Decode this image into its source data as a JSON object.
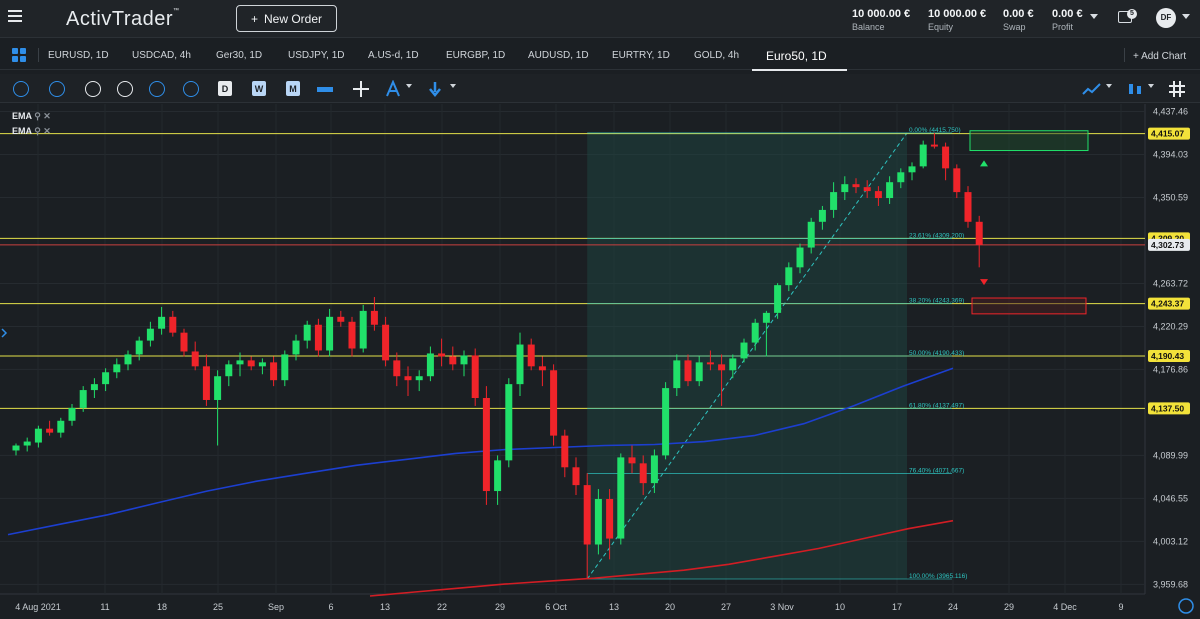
{
  "header": {
    "logo": "ActivTrader",
    "logo_tm": "™",
    "new_order": "New Order",
    "new_order_plus": "+",
    "balance": {
      "value": "10 000.00 €",
      "label": "Balance"
    },
    "equity": {
      "value": "10 000.00 €",
      "label": "Equity"
    },
    "swap": {
      "value": "0.00 €",
      "label": "Swap"
    },
    "profit": {
      "value": "0.00 €",
      "label": "Profit"
    },
    "notifications": "5",
    "avatar": "DF"
  },
  "tabs": [
    {
      "label": "EURUSD, 1D"
    },
    {
      "label": "USDCAD, 4h"
    },
    {
      "label": "Ger30, 1D"
    },
    {
      "label": "USDJPY, 1D"
    },
    {
      "label": "A.US-d, 1D"
    },
    {
      "label": "EURGBP, 1D"
    },
    {
      "label": "AUDUSD, 1D"
    },
    {
      "label": "EURTRY, 1D"
    },
    {
      "label": "GOLD, 4h"
    },
    {
      "label": "Euro50, 1D"
    }
  ],
  "active_tab": "Euro50, 1D",
  "add_chart": "+ Add Chart",
  "toolbar": {
    "letter_tools": [
      "D",
      "W",
      "M"
    ]
  },
  "indicators": [
    {
      "label": "EMA"
    },
    {
      "label": "EMA"
    }
  ],
  "colors": {
    "up": "#21e06a",
    "down": "#f0242a",
    "ema_fast": "#1c3fd0",
    "ema_slow": "#d21d24",
    "accent": "#2f8ee8",
    "level": "#e3e04a",
    "fib": "#2ec4c0"
  },
  "chart_data": {
    "type": "candlestick",
    "instrument": "Euro50",
    "timeframe": "1D",
    "y_ticks": [
      "4,437.46",
      "4,394.03",
      "4,350.59",
      "4,263.72",
      "4,220.29",
      "4,176.86",
      "4,089.99",
      "4,046.55",
      "4,003.12",
      "3,959.68"
    ],
    "x_ticks": [
      "4 Aug 2021",
      "11",
      "18",
      "25",
      "Sep",
      "6",
      "13",
      "22",
      "29",
      "6 Oct",
      "13",
      "20",
      "27",
      "3 Nov",
      "10",
      "17",
      "24",
      "29",
      "4 Dec",
      "9"
    ],
    "levels": [
      {
        "price": 4415.07,
        "label": "4,415.07"
      },
      {
        "price": 4309.2,
        "label": "4,309.20"
      },
      {
        "price": 4302.73,
        "label": "4,302.73"
      },
      {
        "price": 4243.37,
        "label": "4,243.37"
      },
      {
        "price": 4190.43,
        "label": "4,190.43"
      },
      {
        "price": 4137.5,
        "label": "4,137.50"
      }
    ],
    "fibonacci": [
      {
        "price": 4415.75,
        "label": "0.00% (4415.750)"
      },
      {
        "price": 4309.2,
        "label": "23.61% (4309.200)"
      },
      {
        "price": 4243.369,
        "label": "38.20% (4243.369)"
      },
      {
        "price": 4190.433,
        "label": "50.00% (4190.433)"
      },
      {
        "price": 4137.497,
        "label": "61.80% (4137.497)"
      },
      {
        "price": 4071.667,
        "label": "76.40% (4071.667)"
      },
      {
        "price": 3965.116,
        "label": "100.00% (3965.116)"
      }
    ],
    "candles": [
      [
        4095,
        4102,
        4090,
        4100
      ],
      [
        4100,
        4108,
        4094,
        4104
      ],
      [
        4103,
        4120,
        4098,
        4117
      ],
      [
        4117,
        4125,
        4110,
        4113
      ],
      [
        4113,
        4128,
        4108,
        4125
      ],
      [
        4125,
        4142,
        4120,
        4138
      ],
      [
        4138,
        4160,
        4134,
        4156
      ],
      [
        4156,
        4168,
        4148,
        4162
      ],
      [
        4162,
        4178,
        4155,
        4174
      ],
      [
        4174,
        4188,
        4168,
        4182
      ],
      [
        4182,
        4196,
        4176,
        4192
      ],
      [
        4192,
        4210,
        4186,
        4206
      ],
      [
        4206,
        4225,
        4200,
        4218
      ],
      [
        4218,
        4240,
        4212,
        4230
      ],
      [
        4230,
        4236,
        4210,
        4214
      ],
      [
        4214,
        4218,
        4190,
        4195
      ],
      [
        4195,
        4205,
        4176,
        4180
      ],
      [
        4180,
        4192,
        4140,
        4146
      ],
      [
        4146,
        4176,
        4100,
        4170
      ],
      [
        4170,
        4186,
        4160,
        4182
      ],
      [
        4182,
        4194,
        4170,
        4186
      ],
      [
        4186,
        4190,
        4176,
        4180
      ],
      [
        4180,
        4188,
        4172,
        4184
      ],
      [
        4184,
        4190,
        4160,
        4166
      ],
      [
        4166,
        4196,
        4160,
        4192
      ],
      [
        4192,
        4212,
        4186,
        4206
      ],
      [
        4206,
        4226,
        4198,
        4222
      ],
      [
        4222,
        4228,
        4190,
        4196
      ],
      [
        4196,
        4238,
        4190,
        4230
      ],
      [
        4230,
        4236,
        4220,
        4225
      ],
      [
        4225,
        4230,
        4190,
        4198
      ],
      [
        4198,
        4242,
        4194,
        4236
      ],
      [
        4236,
        4250,
        4216,
        4222
      ],
      [
        4222,
        4230,
        4180,
        4186
      ],
      [
        4186,
        4194,
        4160,
        4170
      ],
      [
        4170,
        4180,
        4150,
        4166
      ],
      [
        4166,
        4176,
        4155,
        4170
      ],
      [
        4170,
        4200,
        4165,
        4193
      ],
      [
        4193,
        4208,
        4180,
        4190
      ],
      [
        4190,
        4200,
        4176,
        4182
      ],
      [
        4182,
        4196,
        4170,
        4191
      ],
      [
        4191,
        4198,
        4140,
        4148
      ],
      [
        4148,
        4160,
        4040,
        4054
      ],
      [
        4054,
        4090,
        4040,
        4085
      ],
      [
        4085,
        4168,
        4078,
        4162
      ],
      [
        4162,
        4214,
        4150,
        4202
      ],
      [
        4202,
        4208,
        4176,
        4180
      ],
      [
        4180,
        4190,
        4160,
        4176
      ],
      [
        4176,
        4182,
        4100,
        4110
      ],
      [
        4110,
        4116,
        4068,
        4078
      ],
      [
        4078,
        4088,
        4050,
        4060
      ],
      [
        4060,
        4072,
        3966,
        4000
      ],
      [
        4000,
        4056,
        3990,
        4046
      ],
      [
        4046,
        4056,
        3985,
        4006
      ],
      [
        4006,
        4092,
        4000,
        4088
      ],
      [
        4088,
        4100,
        4072,
        4082
      ],
      [
        4082,
        4090,
        4050,
        4062
      ],
      [
        4062,
        4096,
        4052,
        4090
      ],
      [
        4090,
        4164,
        4086,
        4158
      ],
      [
        4158,
        4192,
        4150,
        4186
      ],
      [
        4186,
        4192,
        4160,
        4165
      ],
      [
        4165,
        4190,
        4160,
        4184
      ],
      [
        4184,
        4196,
        4176,
        4182
      ],
      [
        4182,
        4192,
        4140,
        4176
      ],
      [
        4176,
        4192,
        4168,
        4188
      ],
      [
        4188,
        4208,
        4184,
        4204
      ],
      [
        4204,
        4228,
        4196,
        4224
      ],
      [
        4224,
        4236,
        4190,
        4234
      ],
      [
        4234,
        4264,
        4228,
        4262
      ],
      [
        4262,
        4285,
        4256,
        4280
      ],
      [
        4280,
        4304,
        4274,
        4300
      ],
      [
        4300,
        4330,
        4294,
        4326
      ],
      [
        4326,
        4342,
        4318,
        4338
      ],
      [
        4338,
        4366,
        4330,
        4356
      ],
      [
        4356,
        4372,
        4348,
        4364
      ],
      [
        4364,
        4370,
        4355,
        4361
      ],
      [
        4361,
        4368,
        4350,
        4357
      ],
      [
        4357,
        4362,
        4342,
        4350
      ],
      [
        4350,
        4372,
        4344,
        4366
      ],
      [
        4366,
        4380,
        4360,
        4376
      ],
      [
        4376,
        4386,
        4368,
        4382
      ],
      [
        4382,
        4408,
        4380,
        4404
      ],
      [
        4404,
        4415.75,
        4400,
        4402
      ],
      [
        4402,
        4406,
        4368,
        4380
      ],
      [
        4380,
        4384,
        4350,
        4356
      ],
      [
        4356,
        4362,
        4320,
        4326
      ],
      [
        4326,
        4332,
        4280,
        4302.73
      ]
    ],
    "ema_fast": [
      4010,
      4020,
      4030,
      4042,
      4054,
      4064,
      4072,
      4080,
      4086,
      4092,
      4096,
      4098,
      4100,
      4101,
      4104,
      4110,
      4122,
      4140,
      4160,
      4178
    ],
    "ema_slow": [
      3948,
      3952,
      3956,
      3960,
      3963,
      3966,
      3970,
      3974,
      3980,
      3988,
      3996,
      4006,
      4016,
      4024
    ],
    "ylim": [
      3950,
      4445
    ],
    "grid": true
  }
}
